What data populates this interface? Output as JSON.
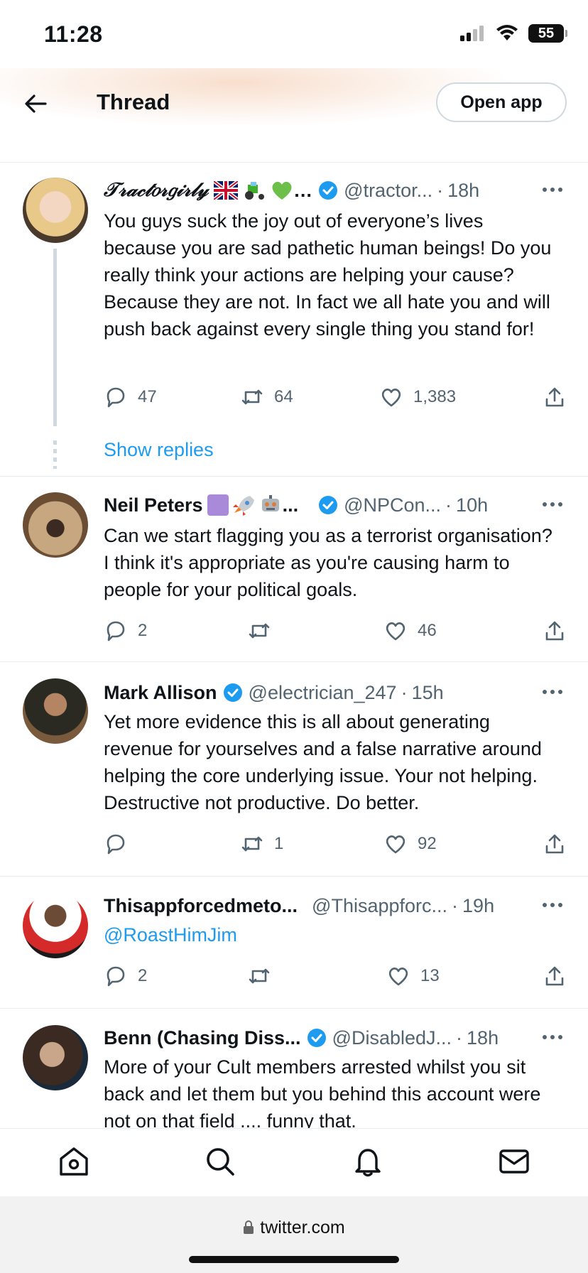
{
  "status_bar": {
    "time": "11:28",
    "battery": "55"
  },
  "header": {
    "title": "Thread",
    "open_app": "Open app"
  },
  "thread_tweet": {
    "name": "𝒯𝓇𝒶𝒸𝓉𝑜𝓇𝑔𝒾𝓇𝓁𝓎",
    "name_emoji_suffix": "…",
    "handle": "@tractor...",
    "time": "18h",
    "text": "You guys suck the joy out of everyone’s lives because you are sad pathetic human beings! Do you really think your actions are helping your cause? Because they are not. In fact we all hate you and will push back against every single thing you stand for!",
    "replies": "47",
    "retweets": "64",
    "likes": "1,383",
    "show_replies": "Show replies"
  },
  "tweets": [
    {
      "name": "Neil Peters",
      "name_suffix": "...",
      "handle": "@NPCon...",
      "time": "10h",
      "text": "Can we start flagging you as a terrorist organisation? I think it's appropriate as you're causing harm to people for your political goals.",
      "replies": "2",
      "retweets": "",
      "likes": "46"
    },
    {
      "name": "Mark Allison",
      "handle": "@electrician_247",
      "time": "15h",
      "text": "Yet more evidence this is all about generating revenue for yourselves and a false narrative around helping the core underlying issue. Your not helping. Destructive not productive. Do better.",
      "replies": "",
      "retweets": "1",
      "likes": "92"
    },
    {
      "name": "Thisappforcedmeto...",
      "handle": "@Thisappforc...",
      "time": "19h",
      "text": "@RoastHimJim",
      "replies": "2",
      "retweets": "",
      "likes": "13"
    },
    {
      "name": "Benn (Chasing Diss...",
      "handle": "@DisabledJ...",
      "time": "18h",
      "text": "More of your Cult members arrested whilst you sit back and let them but you behind this account were not on that field .... funny that."
    }
  ],
  "browser": {
    "url": "twitter.com"
  },
  "colors": {
    "accent": "#1d9bf0",
    "muted": "#536471",
    "divider": "#e6ecf0"
  }
}
